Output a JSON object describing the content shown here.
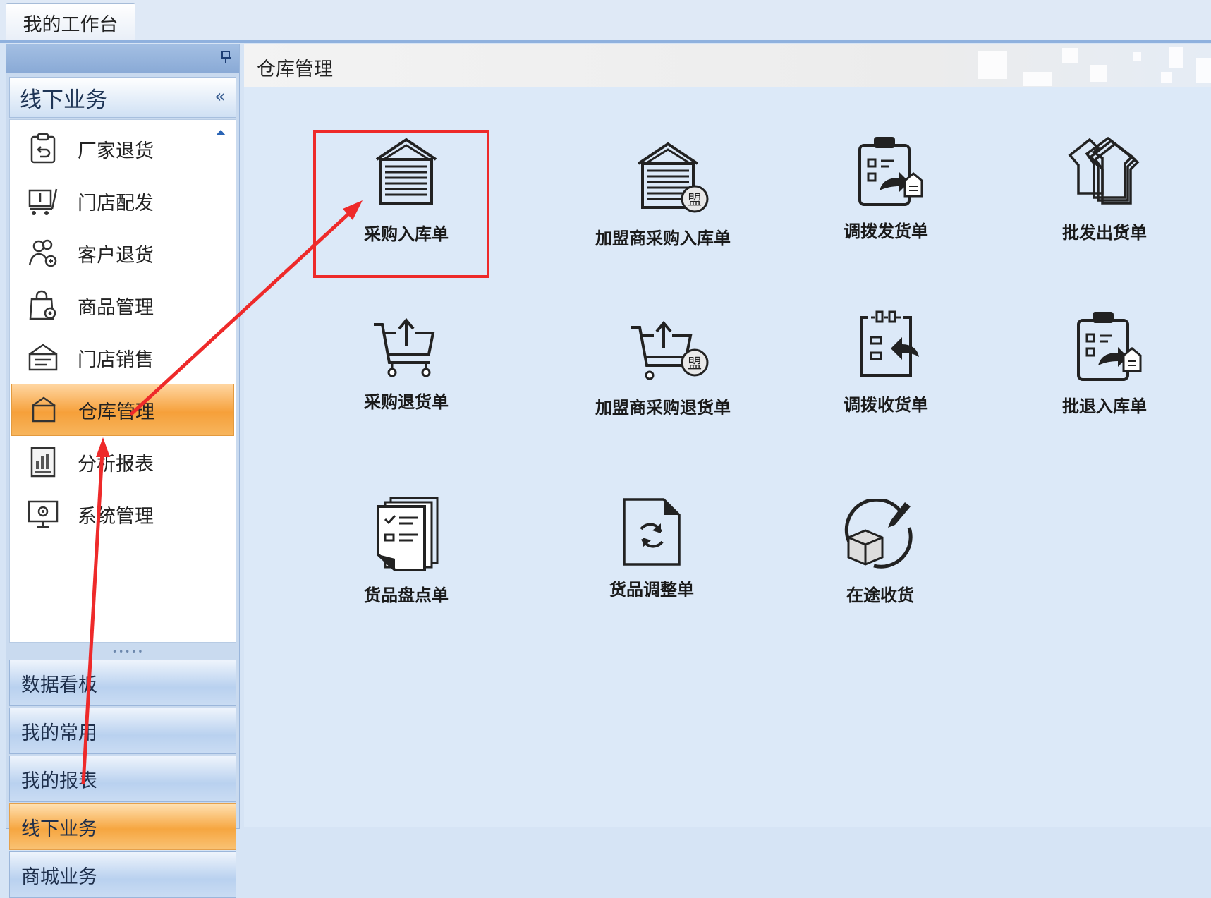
{
  "top_tab": {
    "label": "我的工作台"
  },
  "sidebar": {
    "title": "线下业务",
    "items": [
      {
        "label": "厂家退货",
        "icon": "return-clipboard-icon"
      },
      {
        "label": "门店配发",
        "icon": "cart-distribute-icon"
      },
      {
        "label": "客户退货",
        "icon": "customer-return-icon"
      },
      {
        "label": "商品管理",
        "icon": "bag-gear-icon"
      },
      {
        "label": "门店销售",
        "icon": "store-sales-icon"
      },
      {
        "label": "仓库管理",
        "icon": "warehouse-icon"
      },
      {
        "label": "分析报表",
        "icon": "report-chart-icon"
      },
      {
        "label": "系统管理",
        "icon": "monitor-gear-icon"
      }
    ],
    "active_item": "仓库管理",
    "stack": [
      {
        "label": "数据看板"
      },
      {
        "label": "我的常用"
      },
      {
        "label": "我的报表"
      },
      {
        "label": "线下业务"
      },
      {
        "label": "商城业务"
      }
    ],
    "active_stack": "线下业务"
  },
  "main": {
    "title": "仓库管理",
    "tiles": [
      {
        "label": "采购入库单",
        "icon": "warehouse-door-icon"
      },
      {
        "label": "加盟商采购入库单",
        "icon": "warehouse-door-franchise-icon"
      },
      {
        "label": "调拨发货单",
        "icon": "clipboard-transfer-out-icon"
      },
      {
        "label": "批发出货单",
        "icon": "stacked-houses-icon"
      },
      {
        "label": "采购退货单",
        "icon": "cart-upload-icon"
      },
      {
        "label": "加盟商采购退货单",
        "icon": "cart-upload-franchise-icon"
      },
      {
        "label": "调拨收货单",
        "icon": "clipboard-receive-icon"
      },
      {
        "label": "批退入库单",
        "icon": "clipboard-return-in-icon"
      },
      {
        "label": "货品盘点单",
        "icon": "checklist-stack-icon"
      },
      {
        "label": "货品调整单",
        "icon": "document-refresh-icon"
      },
      {
        "label": "在途收货",
        "icon": "box-transit-icon"
      }
    ],
    "franchise_badge": "盟",
    "highlighted_tile": "采购入库单"
  },
  "annotation_color": "#ee2a2a"
}
